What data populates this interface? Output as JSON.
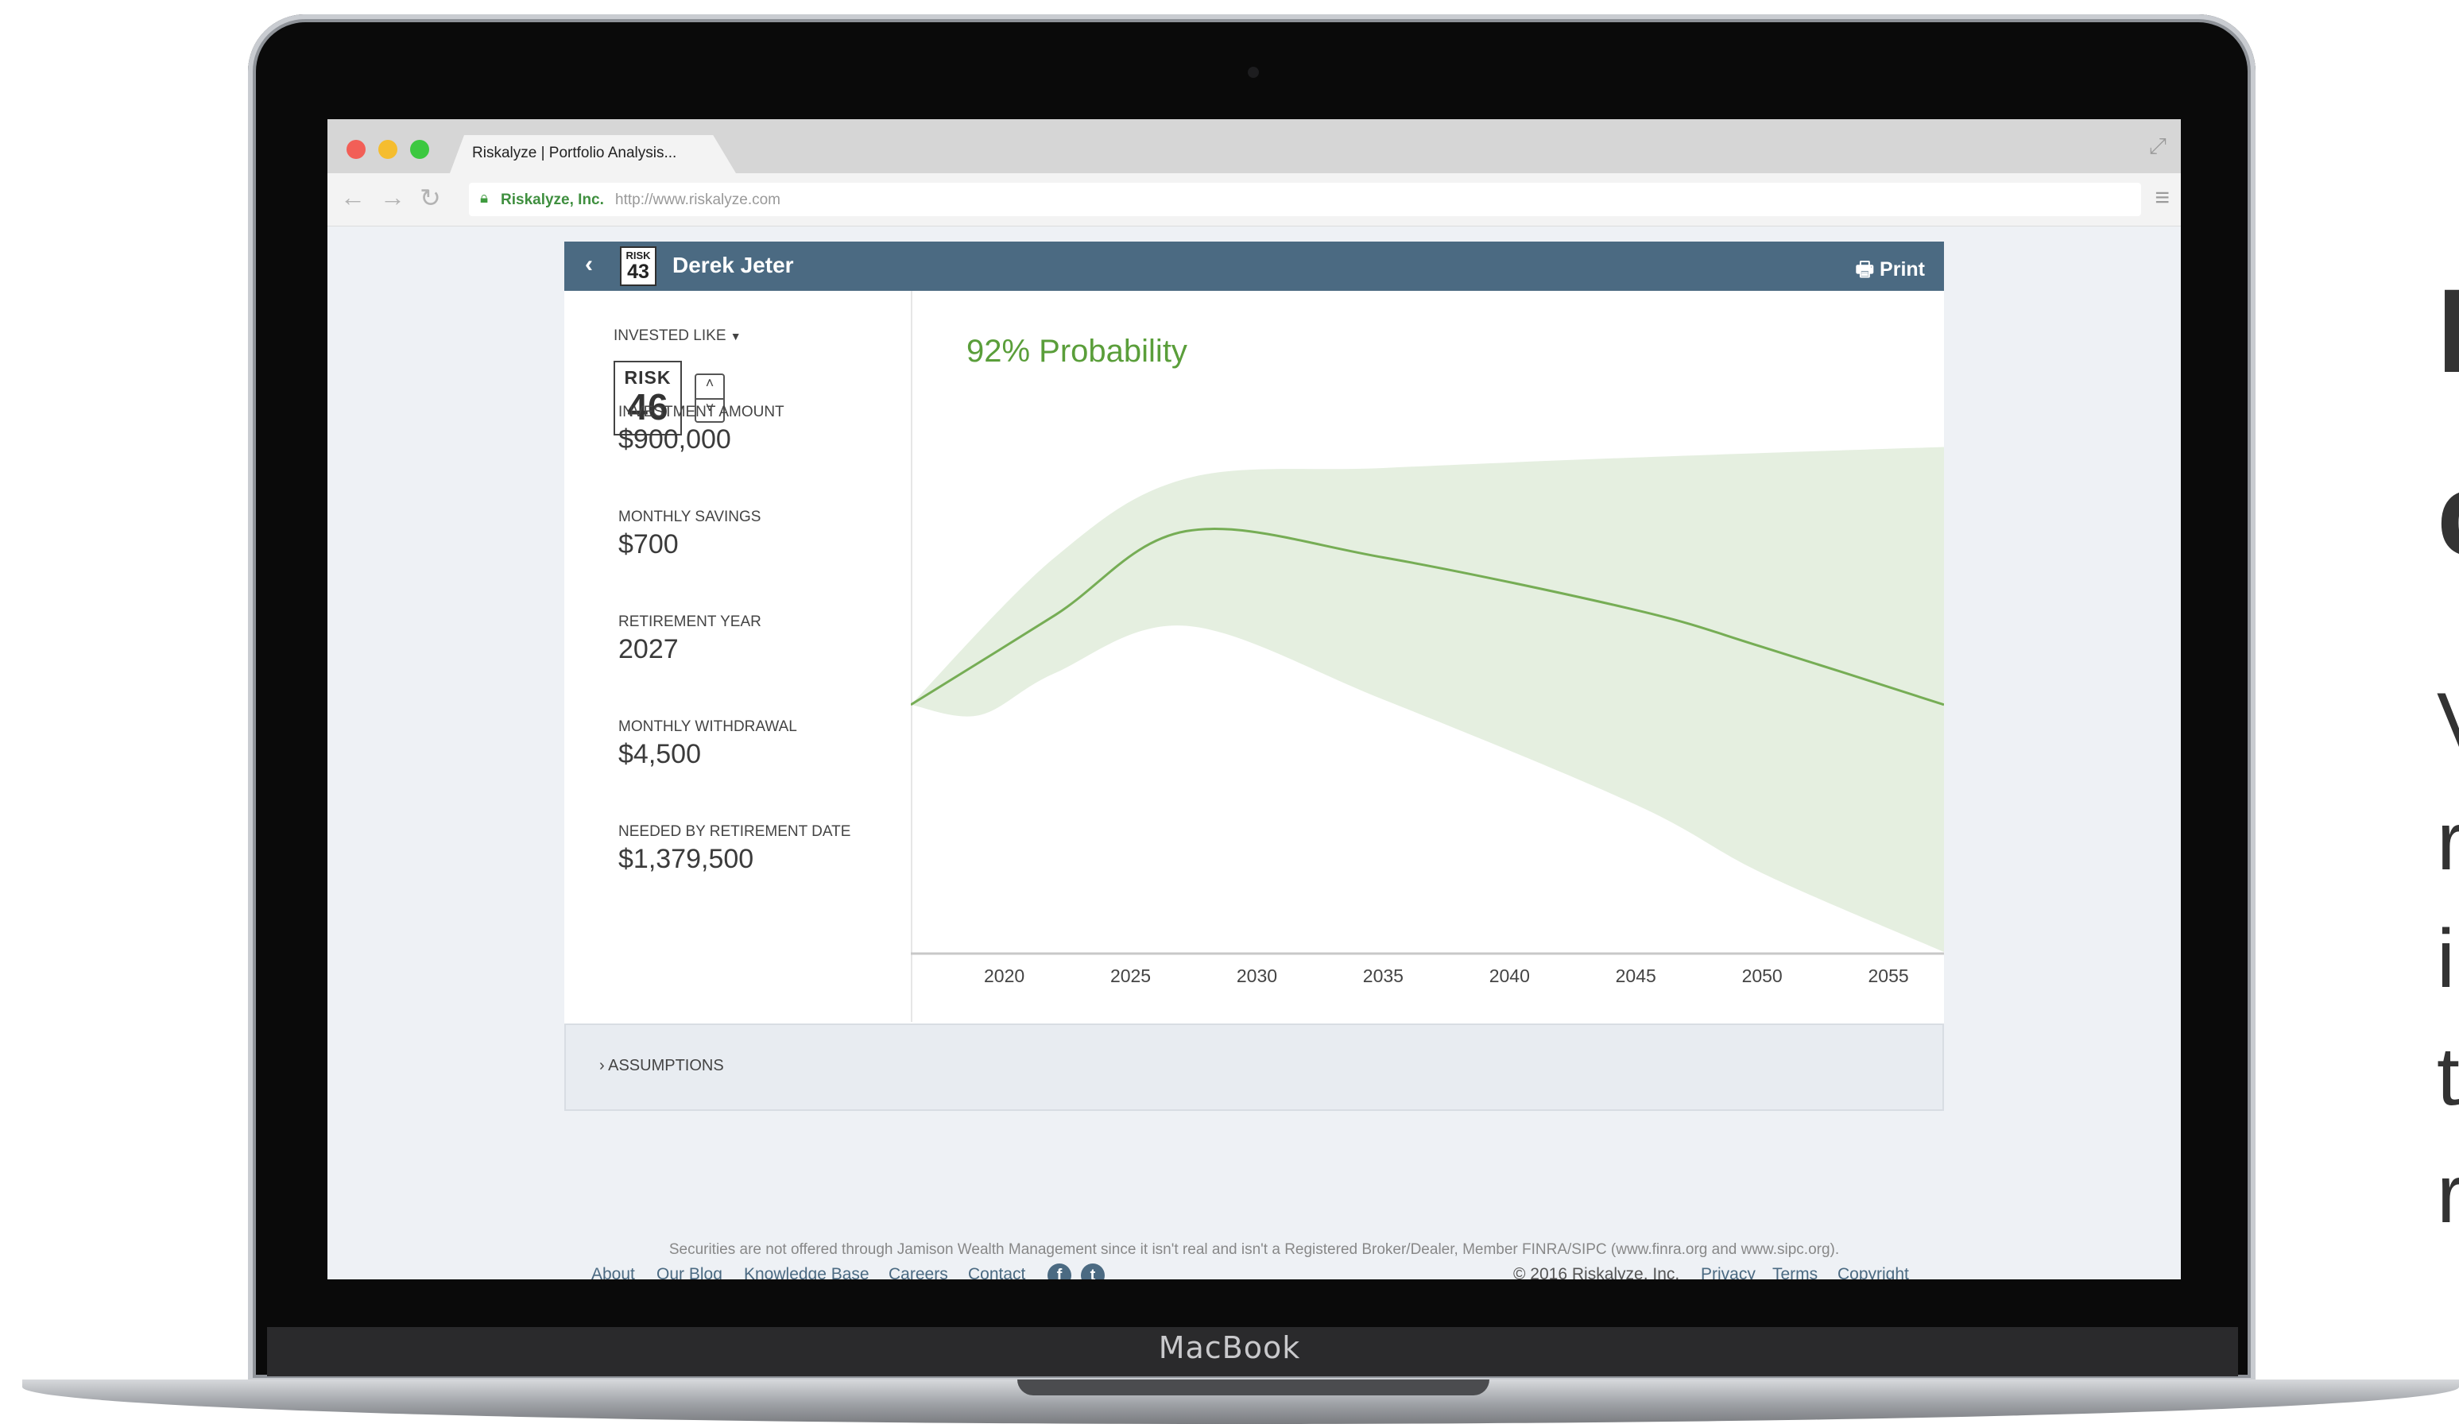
{
  "device": {
    "label": "MacBook"
  },
  "browser": {
    "tab_title": "Riskalyze | Portfolio Analysis...",
    "site_name": "Riskalyze, Inc.",
    "url": "http://www.riskalyze.com"
  },
  "header": {
    "badge_label": "RISK",
    "badge_number": "43",
    "client_name": "Derek Jeter",
    "print_label": "Print"
  },
  "inputs": {
    "invested_like_label": "INVESTED LIKE",
    "risk_label": "RISK",
    "risk_number": "46",
    "fields": [
      {
        "label": "INVESTMENT AMOUNT",
        "value": "$900,000"
      },
      {
        "label": "MONTHLY SAVINGS",
        "value": "$700"
      },
      {
        "label": "RETIREMENT YEAR",
        "value": "2027"
      },
      {
        "label": "MONTHLY WITHDRAWAL",
        "value": "$4,500"
      },
      {
        "label": "NEEDED BY RETIREMENT DATE",
        "value": "$1,379,500"
      }
    ]
  },
  "chart": {
    "probability_label": "92% Probability",
    "colors": {
      "line": "#76ad55",
      "band": "#e5efe0",
      "axis": "#c8c8c8",
      "label": "#444444"
    }
  },
  "chart_data": {
    "type": "area",
    "title": "92% Probability",
    "xlabel": "",
    "ylabel": "",
    "x_ticks": [
      2020,
      2025,
      2030,
      2035,
      2040,
      2045,
      2050,
      2055
    ],
    "xlim": [
      2016.3,
      2057.2
    ],
    "ylim": [
      0,
      100
    ],
    "series": [
      {
        "role": "median",
        "x": [
          2016.3,
          2022,
          2027.2,
          2035,
          2045,
          2050,
          2057.2
        ],
        "y": [
          47,
          64,
          80,
          75,
          65,
          58,
          47
        ]
      },
      {
        "role": "upper",
        "x": [
          2016.3,
          2022,
          2027.2,
          2035,
          2045,
          2057.2
        ],
        "y": [
          47,
          75,
          90,
          92,
          94,
          96
        ]
      },
      {
        "role": "lower",
        "x": [
          2016.3,
          2019,
          2022,
          2027.2,
          2035,
          2045,
          2050,
          2057.2
        ],
        "y": [
          47,
          45,
          53,
          62,
          48,
          28,
          15,
          0
        ]
      }
    ]
  },
  "assumptions": {
    "label": "ASSUMPTIONS"
  },
  "footer": {
    "links": [
      "About",
      "Our Blog",
      "Knowledge Base",
      "Careers",
      "Contact"
    ],
    "social": [
      {
        "icon": "facebook-icon",
        "glyph": "f"
      },
      {
        "icon": "twitter-icon",
        "glyph": "t"
      }
    ],
    "copyright": "© 2016 Riskalyze, Inc.",
    "legal_links": [
      "Privacy",
      "Terms",
      "Copyright"
    ],
    "disclaimer": "Securities are not offered through Jamison Wealth Management since it isn't real and isn't a Registered Broker/Dealer, Member FINRA/SIPC (www.finra.org and www.sipc.org)."
  },
  "hero_fragment": {
    "lines": [
      "I",
      "c",
      "V",
      "r",
      "ir",
      "t",
      "r"
    ]
  }
}
